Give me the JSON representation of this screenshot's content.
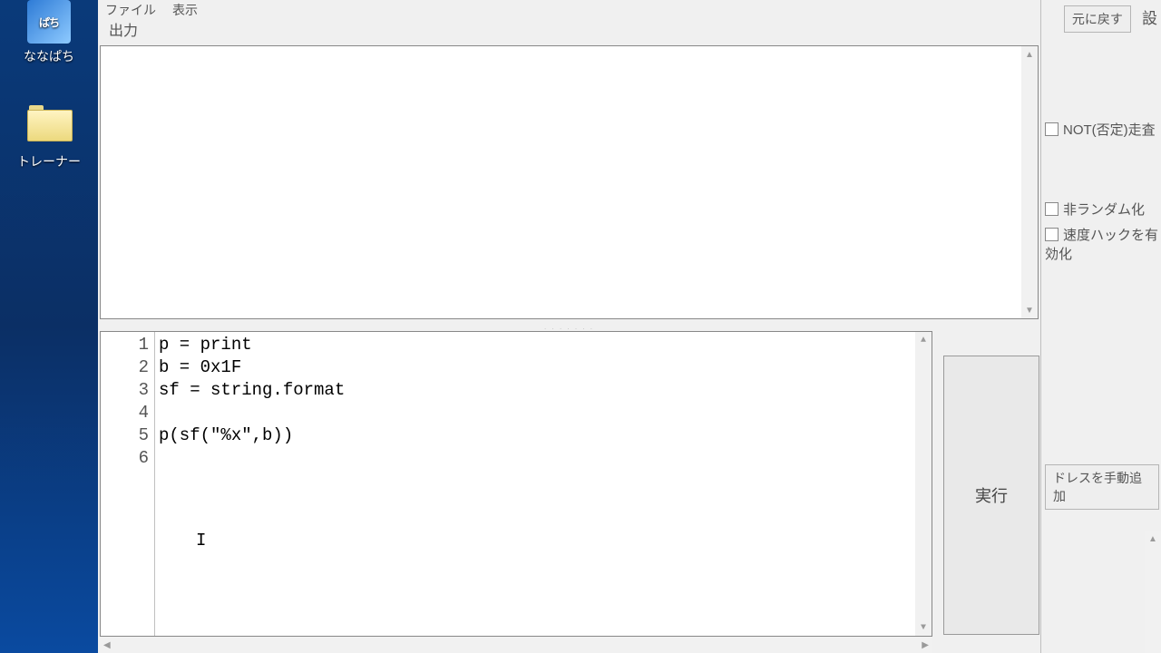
{
  "desktop": {
    "icons": [
      {
        "name": "app-nanapachi",
        "label": "ななぱち",
        "kind": "app"
      },
      {
        "name": "folder-trainer",
        "label": "トレーナー",
        "kind": "folder"
      }
    ]
  },
  "lua_window": {
    "menubar": {
      "file": "ファイル",
      "view": "表示"
    },
    "output_label": "出力",
    "output_text": "",
    "splitter_glyph": ". . . . . . .",
    "run_button": "実行",
    "code_lines": [
      "p = print",
      "b = 0x1F",
      "sf = string.format",
      "",
      "p(sf(\"%x\",b))",
      ""
    ],
    "caret_glyph": "I"
  },
  "ce_window": {
    "settings_label": "設",
    "undo_button": "元に戻す",
    "not_scan": "NOT(否定)走査",
    "derandomize": "非ランダム化",
    "speedhack": "速度ハックを有効化",
    "add_address": "ドレスを手動追加"
  }
}
